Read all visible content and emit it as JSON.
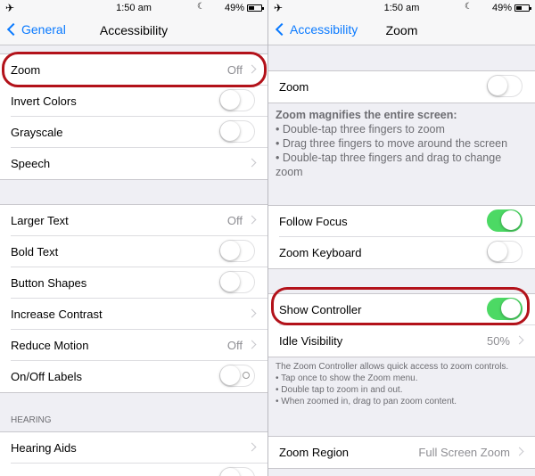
{
  "left": {
    "status": {
      "time": "1:50 am",
      "battery": "49%"
    },
    "nav": {
      "back": "General",
      "title": "Accessibility"
    },
    "group1": [
      {
        "label": "Zoom",
        "value": "Off",
        "type": "link"
      },
      {
        "label": "Invert Colors",
        "type": "toggle",
        "on": false
      },
      {
        "label": "Grayscale",
        "type": "toggle",
        "on": false
      },
      {
        "label": "Speech",
        "type": "link"
      }
    ],
    "group2": [
      {
        "label": "Larger Text",
        "value": "Off",
        "type": "link"
      },
      {
        "label": "Bold Text",
        "type": "toggle",
        "on": false
      },
      {
        "label": "Button Shapes",
        "type": "toggle",
        "on": false
      },
      {
        "label": "Increase Contrast",
        "type": "link"
      },
      {
        "label": "Reduce Motion",
        "value": "Off",
        "type": "link"
      },
      {
        "label": "On/Off Labels",
        "type": "toggle",
        "on": false
      }
    ],
    "hearing_header": "HEARING",
    "group3": [
      {
        "label": "Hearing Aids",
        "type": "link"
      }
    ]
  },
  "right": {
    "status": {
      "time": "1:50 am",
      "battery": "49%"
    },
    "nav": {
      "back": "Accessibility",
      "title": "Zoom"
    },
    "zoom_row": {
      "label": "Zoom",
      "on": false
    },
    "zoom_desc": {
      "title": "Zoom magnifies the entire screen:",
      "lines": [
        "• Double-tap three fingers to zoom",
        "• Drag three fingers to move around the screen",
        "• Double-tap three fingers and drag to change zoom"
      ]
    },
    "focus_group": [
      {
        "label": "Follow Focus",
        "on": true
      },
      {
        "label": "Zoom Keyboard",
        "on": false
      }
    ],
    "controller_group": [
      {
        "label": "Show Controller",
        "type": "toggle",
        "on": true
      },
      {
        "label": "Idle Visibility",
        "value": "50%",
        "type": "link"
      }
    ],
    "controller_note": {
      "text": "The Zoom Controller allows quick access to zoom controls.",
      "lines": [
        "• Tap once to show the Zoom menu.",
        "• Double tap to zoom in and out.",
        "• When zoomed in, drag to pan zoom content."
      ]
    },
    "region_row": {
      "label": "Zoom Region",
      "value": "Full Screen Zoom"
    }
  },
  "colors": {
    "accent": "#0a7aff",
    "toggle_on": "#4cd964",
    "highlight": "#b3121a"
  }
}
